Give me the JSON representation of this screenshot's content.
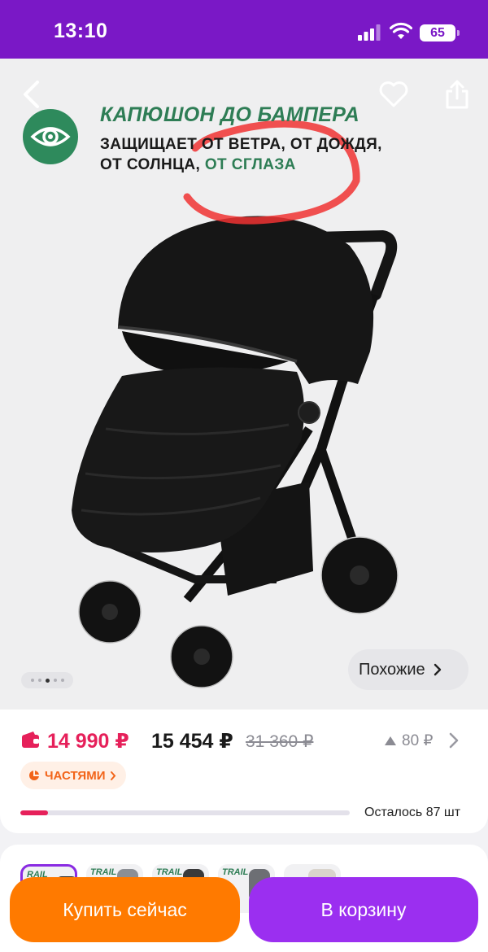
{
  "status_bar": {
    "time": "13:10",
    "battery": "65"
  },
  "promo": {
    "title": "КАПЮШОН ДО БАМПЕРА",
    "line1": "ЗАЩИЩАЕТ ОТ ВЕТРА, ОТ ДОЖДЯ,",
    "line2_prefix": "ОТ СОЛНЦА, ",
    "line2_highlight": "ОТ СГЛАЗА"
  },
  "gallery": {
    "dots_count": 5,
    "active_dot": 3
  },
  "similar_label": "Похожие",
  "price": {
    "card_price": "14 990 ₽",
    "price": "15 454 ₽",
    "old_price": "31 360 ₽",
    "bonus": "80 ₽",
    "installments_label": "ЧАСТЯМИ",
    "stock_left": "Осталось 87 шт",
    "stock_progress": 0.085
  },
  "variants": [
    {
      "label": "RAIL",
      "selected": true
    },
    {
      "label": "TRAIL",
      "selected": false
    },
    {
      "label": "TRAIL",
      "selected": false
    },
    {
      "label": "TRAIL",
      "selected": false
    },
    {
      "label": "",
      "selected": false
    }
  ],
  "actions": {
    "buy_now": "Купить сейчас",
    "add_to_cart": "В корзину"
  },
  "colors": {
    "status_bar": "#7a18c6",
    "price_accent": "#e6205a",
    "buy": "#ff7a00",
    "cart": "#9b2ff0",
    "promo_green": "#2e7d55"
  },
  "icons": [
    "back-icon",
    "heart-icon",
    "share-icon",
    "eye-icon",
    "wallet-icon",
    "chevron-right-icon",
    "triangle-up-icon",
    "pie-icon"
  ]
}
